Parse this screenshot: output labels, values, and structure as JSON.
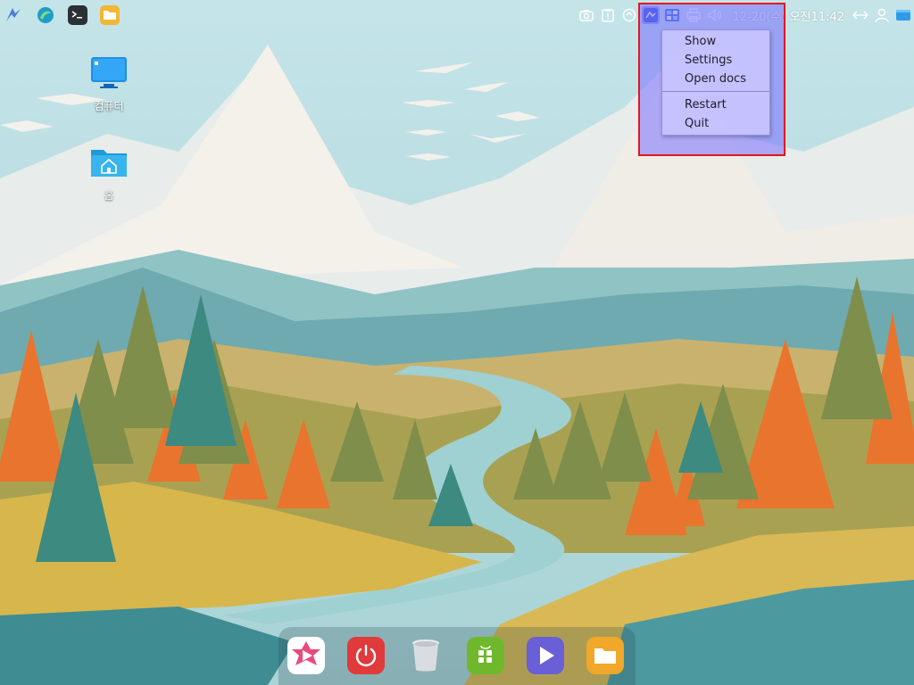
{
  "desktop": {
    "icons": [
      {
        "label": "컴퓨터",
        "icon": "computer-icon"
      },
      {
        "label": "홈",
        "icon": "home-folder-icon"
      }
    ]
  },
  "top_panel": {
    "apps": [
      {
        "icon": "kylin-start-icon"
      },
      {
        "icon": "browser-icon"
      },
      {
        "icon": "terminal-icon"
      },
      {
        "icon": "file-manager-icon"
      }
    ],
    "tray": [
      {
        "icon": "screenshot-icon"
      },
      {
        "icon": "clipboard-icon"
      },
      {
        "icon": "network-icon"
      },
      {
        "icon": "app-tray-icon"
      },
      {
        "icon": "palette-icon"
      },
      {
        "icon": "printer-icon"
      },
      {
        "icon": "volume-icon"
      }
    ],
    "clock": "12-20(수) 오전11:42",
    "tail_icons": [
      {
        "icon": "expand-arrows-icon"
      },
      {
        "icon": "user-icon"
      },
      {
        "icon": "show-desktop-icon"
      }
    ]
  },
  "tray_menu": {
    "items_top": [
      "Show",
      "Settings",
      "Open docs"
    ],
    "items_bottom": [
      "Restart",
      "Quit"
    ]
  },
  "dock": {
    "items": [
      {
        "icon": "video-player-icon"
      },
      {
        "icon": "power-icon"
      },
      {
        "icon": "trash-icon"
      },
      {
        "icon": "software-store-icon"
      },
      {
        "icon": "media-play-icon"
      },
      {
        "icon": "folder-icon"
      }
    ]
  },
  "colors": {
    "highlight_border": "#e8141c",
    "menu_bg": "#c8c3ff"
  }
}
